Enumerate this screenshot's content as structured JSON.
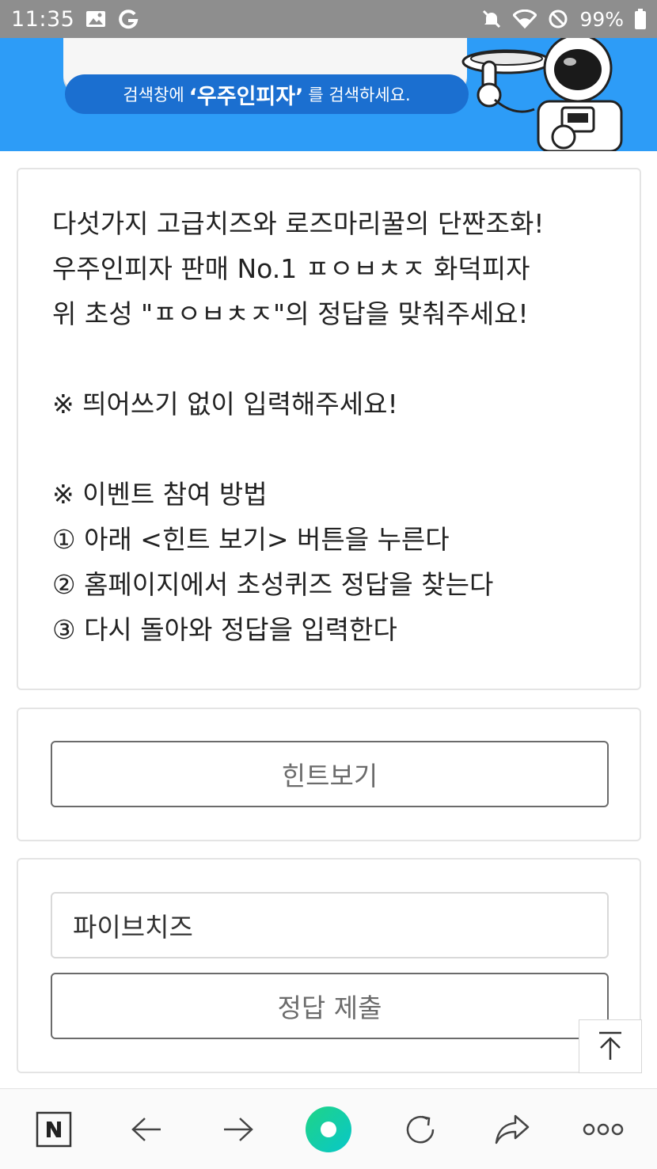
{
  "status_bar": {
    "time": "11:35",
    "battery": "99%",
    "icons": [
      "gallery-icon",
      "g-app-icon",
      "mute-icon",
      "wifi-icon",
      "do-not-disturb-icon",
      "battery-icon"
    ]
  },
  "banner": {
    "search_prefix": "검색창에",
    "search_keyword": "‘우주인피자’",
    "search_suffix": "를 검색하세요.",
    "colors": {
      "background": "#2d9cf7",
      "pill": "#1b6fd0"
    }
  },
  "quiz": {
    "lines": [
      "다섯가지 고급치즈와 로즈마리꿀의 단짠조화!",
      "우주인피자 판매 No.1 ㅍㅇㅂㅊㅈ 화덕피자",
      "위 초성 \"ㅍㅇㅂㅊㅈ\"의 정답을 맞춰주세요!",
      "",
      "※ 띄어쓰기 없이 입력해주세요!",
      "",
      "※ 이벤트 참여 방법",
      "① 아래 <힌트 보기> 버튼을 누른다",
      "② 홈페이지에서 초성퀴즈 정답을 찾는다",
      "③ 다시 돌아와 정답을 입력한다"
    ]
  },
  "hint_button": {
    "label": "힌트보기"
  },
  "answer": {
    "input_value": "파이브치즈",
    "submit_label": "정답 제출"
  },
  "bottom_nav": {
    "items": [
      "naver-home-icon",
      "back-arrow-icon",
      "forward-arrow-icon",
      "green-dot-icon",
      "refresh-icon",
      "share-icon",
      "more-icon"
    ]
  }
}
